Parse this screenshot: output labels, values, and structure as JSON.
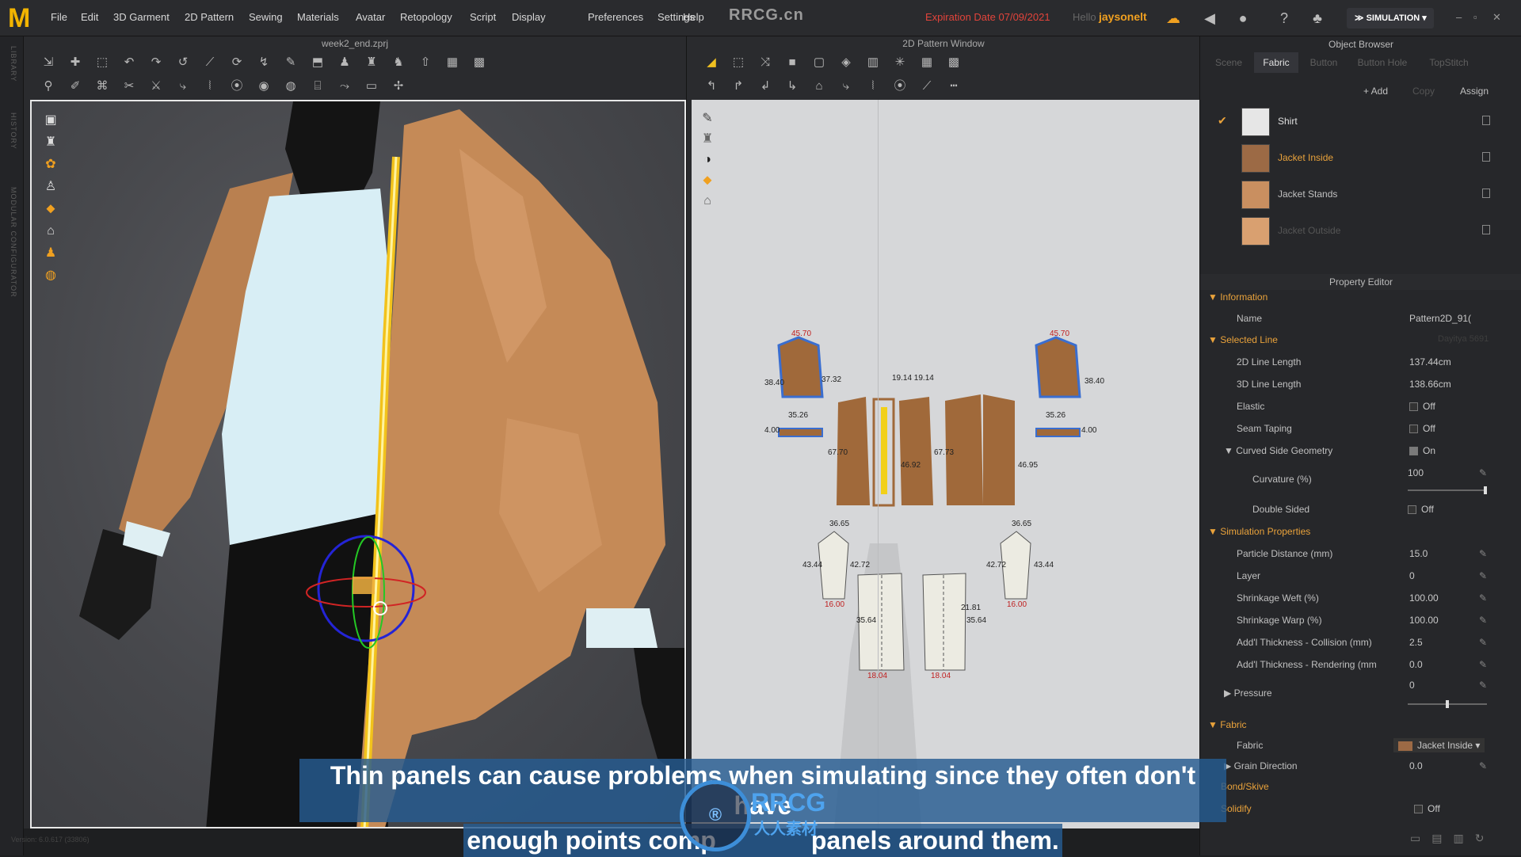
{
  "app": {
    "logo": "M",
    "watermark": "RRCG.cn",
    "expiration": "Expiration Date 07/09/2021",
    "hello": "Hello",
    "username": "jaysonelt",
    "simulation_label": "SIMULATION",
    "version": "Version: 6.0.617 (33806)"
  },
  "menu": [
    "File",
    "Edit",
    "3D Garment",
    "2D Pattern",
    "Sewing",
    "Materials",
    "Avatar",
    "Retopology",
    "Script",
    "Display",
    "Preferences",
    "Settings",
    "Help"
  ],
  "left_strip": [
    "LIBRARY",
    "HISTORY",
    "MODULAR CONFIGURATOR"
  ],
  "window3d": {
    "title": "week2_end.zprj"
  },
  "window2d": {
    "title": "2D Pattern Window"
  },
  "pattern_labels": {
    "sleeve_top": "45.70",
    "sleeve_left": "38.40",
    "sleeve_right": "37.32",
    "sleeve_bottom": "35.26",
    "cuff_left": "4.00",
    "cuff_right": "4.00",
    "top_dims": "19.14 19.14",
    "front_a": "67.70",
    "front_b": "46.92",
    "front_c": "67.73",
    "front_d": "46.95",
    "collar_side": "36.65",
    "collar_a": "43.44",
    "collar_b": "42.72",
    "collar_bottom": "16.00",
    "lower_a": "35.64",
    "lower_b": "21.81",
    "lower_bottom": "18.04"
  },
  "object_browser": {
    "title": "Object Browser",
    "tabs": [
      "Scene",
      "Fabric",
      "Button",
      "Button Hole",
      "TopStitch"
    ],
    "active_tab": "Fabric",
    "actions": [
      "+ Add",
      "Copy",
      "Assign"
    ],
    "materials": [
      {
        "name": "Shirt",
        "color": "#e6e6e6",
        "checked": true,
        "dim": false
      },
      {
        "name": "Jacket Inside",
        "color": "#9c6a45",
        "checked": false,
        "dim": false
      },
      {
        "name": "Jacket Stands",
        "color": "#c98f60",
        "checked": false,
        "dim": false
      },
      {
        "name": "Jacket Outside",
        "color": "#d9a070",
        "checked": false,
        "dim": true
      }
    ]
  },
  "property_editor": {
    "title": "Property Editor",
    "information": "Information",
    "name_label": "Name",
    "name_value": "Pattern2D_91(",
    "selected_line": "Selected Line",
    "selected_line_note": "Dayitya 5691",
    "line2d_label": "2D Line Length",
    "line2d_value": "137.44cm",
    "line3d_label": "3D Line Length",
    "line3d_value": "138.66cm",
    "elastic_label": "Elastic",
    "elastic_value": "Off",
    "seam_label": "Seam Taping",
    "seam_value": "Off",
    "curved_label": "Curved Side Geometry",
    "curved_value": "On",
    "curvature_label": "Curvature (%)",
    "curvature_value": "100",
    "double_label": "Double Sided",
    "double_value": "Off",
    "sim_props": "Simulation Properties",
    "particle_label": "Particle Distance (mm)",
    "particle_value": "15.0",
    "layer_label": "Layer",
    "layer_value": "0",
    "weft_label": "Shrinkage Weft (%)",
    "weft_value": "100.00",
    "warp_label": "Shrinkage Warp (%)",
    "warp_value": "100.00",
    "thick_col_label": "Add'l Thickness - Collision (mm)",
    "thick_col_value": "2.5",
    "thick_ren_label": "Add'l Thickness - Rendering (mm",
    "thick_ren_value": "0.0",
    "pressure_label": "Pressure",
    "pressure_value": "0",
    "fabric_section": "Fabric",
    "fabric_label": "Fabric",
    "fabric_value": "Jacket Inside",
    "grain_label": "Grain Direction",
    "grain_value": "0.0",
    "bond_label": "Bond/Skive",
    "solidify_label": "Solidify",
    "solidify_value": "Off"
  },
  "subtitle": {
    "line1": "Thin panels can cause problems when simulating since they often don't have",
    "line2": "enough points comp",
    "line2_end": "panels around them."
  },
  "badge": {
    "text": "RRCG",
    "cn": "人人素材"
  },
  "colors": {
    "accent": "#e9a23b",
    "jacket": "#c58a57",
    "subtitle_bg": "#265b91"
  }
}
